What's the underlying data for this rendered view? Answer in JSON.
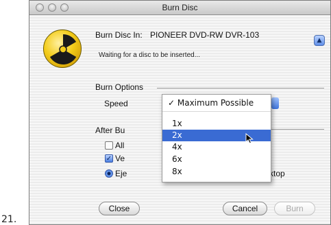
{
  "list_number": "21.",
  "window": {
    "title": "Burn Disc"
  },
  "header": {
    "burn_in_label": "Burn Disc In:",
    "device": "PIONEER DVD-RW DVR-103",
    "status": "Waiting for a disc to be inserted..."
  },
  "burn_options": {
    "heading": "Burn Options",
    "speed_label": "Speed",
    "speed_selected": "Maximum Possible"
  },
  "after_burn": {
    "heading_visible": "After Bu",
    "options": [
      {
        "label_visible": "All",
        "checked": false
      },
      {
        "label_visible": "Ve",
        "checked": true
      },
      {
        "label_visible": "Eje",
        "selected": true
      }
    ],
    "mount_label_visible": "on Desktop"
  },
  "speed_menu": {
    "items": [
      {
        "label": "Maximum Possible",
        "checked": true
      },
      {
        "label": "1x",
        "checked": false
      },
      {
        "label": "2x",
        "checked": false,
        "highlighted": true
      },
      {
        "label": "4x",
        "checked": false
      },
      {
        "label": "6x",
        "checked": false
      },
      {
        "label": "8x",
        "checked": false
      }
    ]
  },
  "buttons": {
    "close": "Close",
    "cancel": "Cancel",
    "burn": "Burn"
  },
  "colors": {
    "menu_highlight": "#3a6bd3",
    "aqua_blue": "#5f8ee8",
    "burn_icon_yellow": "#f3cc1a"
  }
}
